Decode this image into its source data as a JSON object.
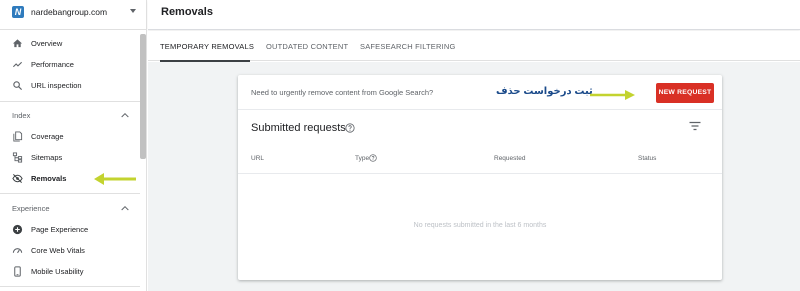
{
  "property": {
    "name": "nardebangroup.com",
    "favicon_letter": "N"
  },
  "sidebar": {
    "top_items": [
      {
        "label": "Overview",
        "icon": "home-icon"
      },
      {
        "label": "Performance",
        "icon": "trending-icon"
      },
      {
        "label": "URL inspection",
        "icon": "search-icon"
      }
    ],
    "index_section": {
      "label": "Index",
      "items": [
        {
          "label": "Coverage",
          "icon": "file-copy-icon"
        },
        {
          "label": "Sitemaps",
          "icon": "sitemap-icon"
        },
        {
          "label": "Removals",
          "icon": "eye-off-icon",
          "active": true
        }
      ]
    },
    "experience_section": {
      "label": "Experience",
      "items": [
        {
          "label": "Page Experience",
          "icon": "plus-circle-icon"
        },
        {
          "label": "Core Web Vitals",
          "icon": "speedometer-icon"
        },
        {
          "label": "Mobile Usability",
          "icon": "smartphone-icon"
        }
      ]
    }
  },
  "header": {
    "title": "Removals"
  },
  "tabs": [
    {
      "label": "TEMPORARY REMOVALS",
      "active": true
    },
    {
      "label": "OUTDATED CONTENT",
      "active": false
    },
    {
      "label": "SAFESEARCH FILTERING",
      "active": false
    }
  ],
  "card": {
    "urgent_text": "Need to urgently remove content from Google Search?",
    "annotation_text": "ثبت درخواست حذف",
    "new_request_label": "NEW REQUEST",
    "submitted_title": "Submitted requests",
    "columns": [
      "URL",
      "Type",
      "Requested",
      "Status"
    ],
    "empty_text": "No requests submitted in the last 6 months"
  },
  "colors": {
    "accent_red": "#d93025",
    "annotation_arrow": "#c3d32f",
    "annotation_text": "#1a4a8a"
  }
}
